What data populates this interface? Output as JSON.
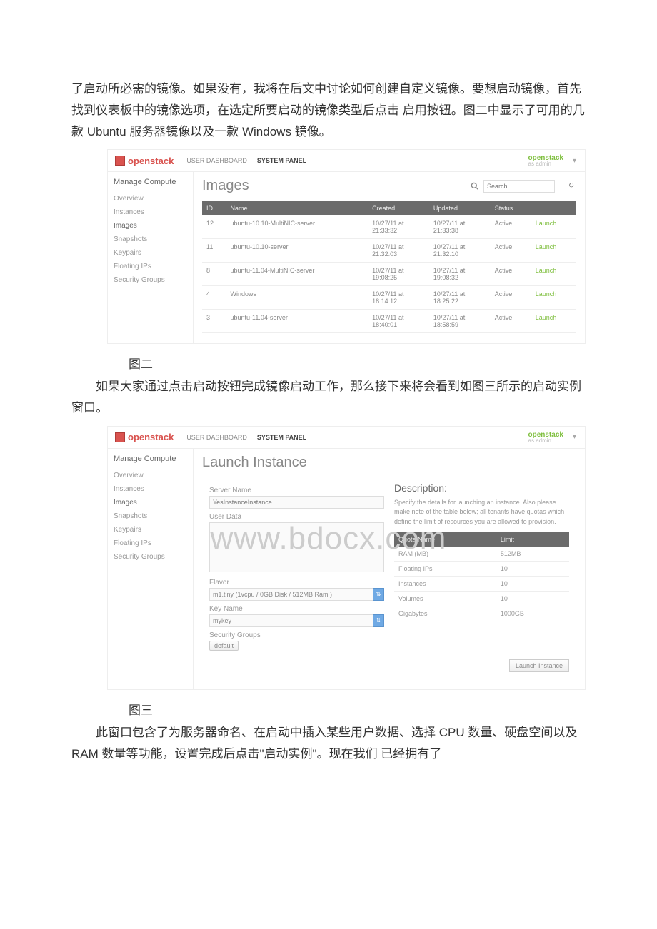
{
  "prose": {
    "p1": "了启动所必需的镜像。如果没有，我将在后文中讨论如何创建自定义镜像。要想启动镜像，首先找到仪表板中的镜像选项，在选定所要启动的镜像类型后点击 启用按钮。图二中显示了可用的几款 Ubuntu 服务器镜像以及一款 Windows 镜像。",
    "fig2": "图二",
    "p2": "如果大家通过点击启动按钮完成镜像启动工作，那么接下来将会看到如图三所示的启动实例窗口。",
    "fig3": "图三",
    "p3": "此窗口包含了为服务器命名、在启动中插入某些用户数据、选择 CPU 数量、硬盘空间以及 RAM 数量等功能，设置完成后点击\"启动实例\"。现在我们 已经拥有了"
  },
  "watermark": "www.bdocx.com",
  "app": {
    "brand": "openstack",
    "nav": {
      "user_dashboard": "USER DASHBOARD",
      "system_panel": "SYSTEM PANEL"
    },
    "org": {
      "name": "openstack",
      "sub": "as admin"
    }
  },
  "sidebar": {
    "title": "Manage Compute",
    "items": [
      "Overview",
      "Instances",
      "Images",
      "Snapshots",
      "Keypairs",
      "Floating IPs",
      "Security Groups"
    ]
  },
  "images_panel": {
    "title": "Images",
    "search_placeholder": "Search...",
    "columns": {
      "id": "ID",
      "name": "Name",
      "created": "Created",
      "updated": "Updated",
      "status": "Status"
    },
    "launch_label": "Launch",
    "rows": [
      {
        "id": "12",
        "name": "ubuntu-10.10-MultiNIC-server",
        "created": "10/27/11 at 21:33:32",
        "updated": "10/27/11 at 21:33:38",
        "status": "Active"
      },
      {
        "id": "11",
        "name": "ubuntu-10.10-server",
        "created": "10/27/11 at 21:32:03",
        "updated": "10/27/11 at 21:32:10",
        "status": "Active"
      },
      {
        "id": "8",
        "name": "ubuntu-11.04-MultiNIC-server",
        "created": "10/27/11 at 19:08:25",
        "updated": "10/27/11 at 19:08:32",
        "status": "Active"
      },
      {
        "id": "4",
        "name": "Windows",
        "created": "10/27/11 at 18:14:12",
        "updated": "10/27/11 at 18:25:22",
        "status": "Active"
      },
      {
        "id": "3",
        "name": "ubuntu-11.04-server",
        "created": "10/27/11 at 18:40:01",
        "updated": "10/27/11 at 18:58:59",
        "status": "Active"
      }
    ]
  },
  "launch_panel": {
    "title": "Launch Instance",
    "labels": {
      "server_name": "Server Name",
      "server_name_placeholder": "YesInstanceInstance",
      "user_data": "User Data",
      "flavor": "Flavor",
      "key_name": "Key Name",
      "security_groups": "Security Groups",
      "description": "Description:",
      "desc_text": "Specify the details for launching an instance. Also please make note of the table below; all tenants have quotas which define the limit of resources you are allowed to provision.",
      "quota_name": "Quota Name",
      "limit": "Limit",
      "submit": "Launch Instance"
    },
    "flavor_value": "m1.tiny (1vcpu / 0GB Disk / 512MB Ram )",
    "key_value": "mykey",
    "sg_value": "default",
    "quotas": [
      {
        "name": "RAM (MB)",
        "limit": "512MB"
      },
      {
        "name": "Floating IPs",
        "limit": "10"
      },
      {
        "name": "Instances",
        "limit": "10"
      },
      {
        "name": "Volumes",
        "limit": "10"
      },
      {
        "name": "Gigabytes",
        "limit": "1000GB"
      }
    ]
  }
}
